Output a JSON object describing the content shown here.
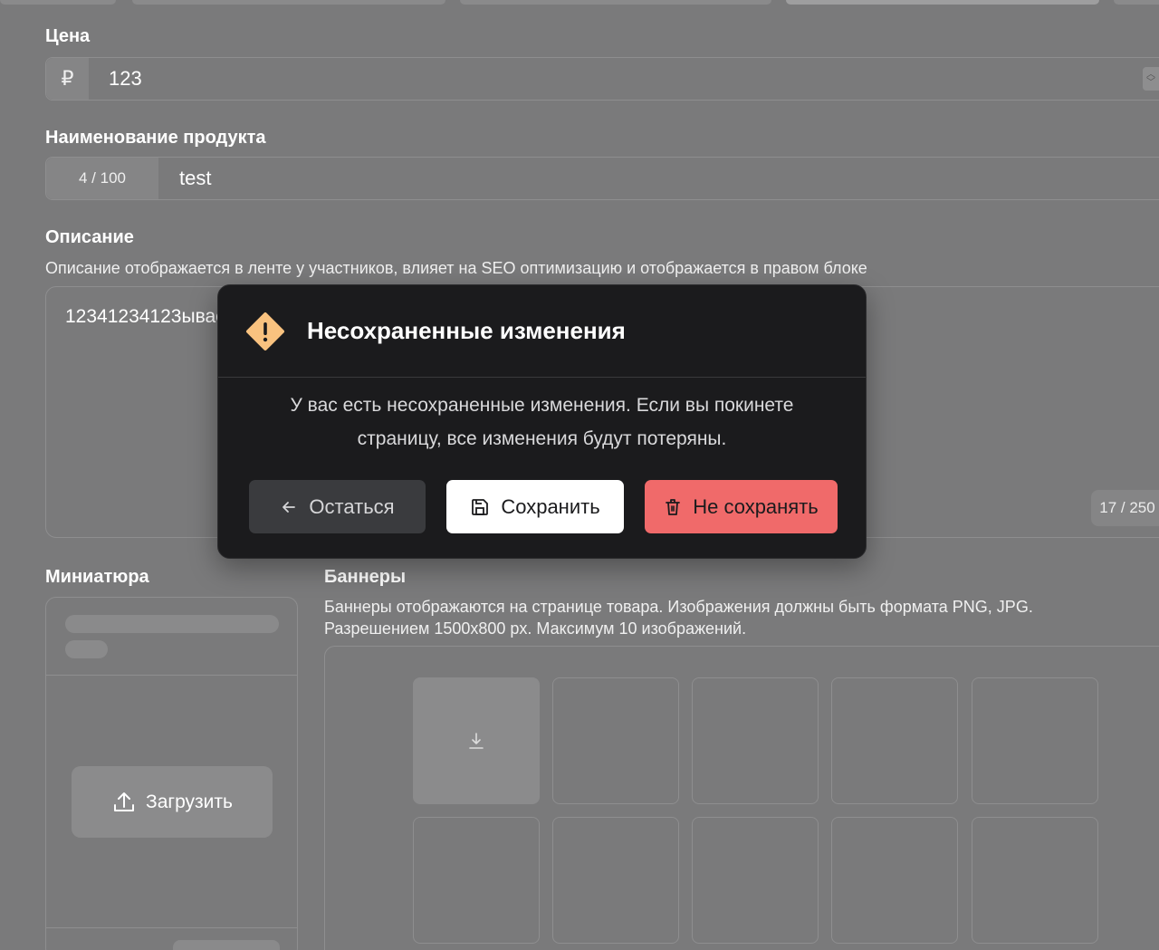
{
  "price": {
    "label": "Цена",
    "currency": "₽",
    "value": "123"
  },
  "product_name": {
    "label": "Наименование продукта",
    "counter": "4 / 100",
    "value": "test"
  },
  "description": {
    "label": "Описание",
    "hint": "Описание отображается в ленте у участников, влияет на SEO оптимизацию и отображается в правом блоке",
    "value": "12341234123ывае",
    "counter": "17 / 250"
  },
  "thumbnail": {
    "label": "Миниатюра",
    "upload_label": "Загрузить"
  },
  "banners": {
    "label": "Баннеры",
    "hint_line1": "Баннеры отображаются на странице товара. Изображения должны быть формата PNG, JPG.",
    "hint_line2": "Разрешением 1500x800 px. Максимум 10 изображений."
  },
  "modal": {
    "title": "Несохраненные изменения",
    "message_line1": "У вас есть несохраненные изменения. Если вы покинете",
    "message_line2": "страницу, все изменения будут потеряны.",
    "stay_label": "Остаться",
    "save_label": "Сохранить",
    "discard_label": "Не сохранять",
    "icon": "warning-icon"
  },
  "colors": {
    "overlay_bg": "#7a7a7b",
    "modal_bg": "#1b1b1d",
    "warning": "#f9c27f",
    "danger": "#f06a6a"
  }
}
